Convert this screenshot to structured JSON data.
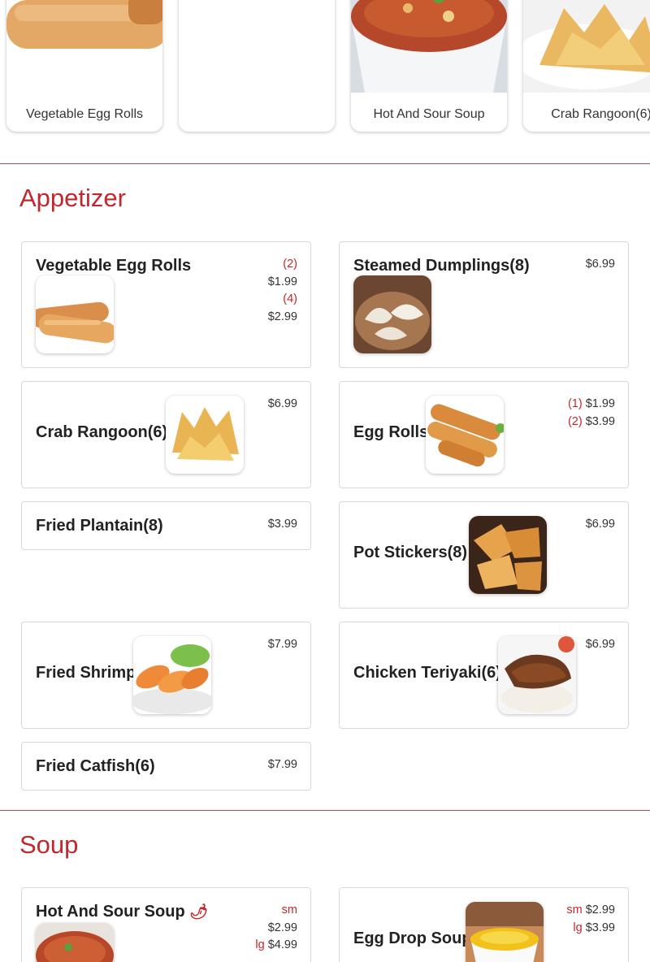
{
  "carousel": {
    "cards": [
      {
        "caption": "Vegetable Egg Rolls",
        "image": "egg-rolls-image"
      },
      {
        "caption": "",
        "image": "blank-image"
      },
      {
        "caption": "Hot And Sour Soup",
        "image": "soup-image"
      },
      {
        "caption": "Crab Rangoon(6)",
        "image": "crab-rangoon-image"
      }
    ]
  },
  "sections": {
    "appetizer": {
      "title": "Appetizer",
      "items": [
        {
          "name": "Vegetable Egg Rolls",
          "prices": [
            {
              "qual": "(2)",
              "price": "$1.99"
            },
            {
              "qual": "(4)",
              "price": "$2.99"
            }
          ]
        },
        {
          "name": "Steamed Dumplings(8)",
          "prices": [
            {
              "qual": "",
              "price": "$6.99"
            }
          ]
        },
        {
          "name": "Crab Rangoon(6)",
          "prices": [
            {
              "qual": "",
              "price": "$6.99"
            }
          ]
        },
        {
          "name": "Egg Rolls",
          "prices": [
            {
              "qual": "(1)",
              "price": "$1.99"
            },
            {
              "qual": "(2)",
              "price": "$3.99"
            }
          ]
        },
        {
          "name": "Fried Plantain(8)",
          "prices": [
            {
              "qual": "",
              "price": "$3.99"
            }
          ]
        },
        {
          "name": "Pot Stickers(8)",
          "prices": [
            {
              "qual": "",
              "price": "$6.99"
            }
          ]
        },
        {
          "name": "Fried Shrimp",
          "prices": [
            {
              "qual": "",
              "price": "$7.99"
            }
          ]
        },
        {
          "name": "Chicken Teriyaki(6)",
          "prices": [
            {
              "qual": "",
              "price": "$6.99"
            }
          ]
        },
        {
          "name": "Fried Catfish(6)",
          "prices": [
            {
              "qual": "",
              "price": "$7.99"
            }
          ]
        }
      ]
    },
    "soup": {
      "title": "Soup",
      "items": [
        {
          "name": "Hot And Sour Soup",
          "spicy_icon": "chili-pepper-icon",
          "prices": [
            {
              "qual": "sm",
              "price": ""
            },
            {
              "qual": "",
              "price": "$2.99"
            },
            {
              "qual": "lg",
              "price": "$4.99"
            }
          ]
        },
        {
          "name": "Egg Drop Soup",
          "prices": [
            {
              "qual": "sm",
              "price": "$2.99"
            },
            {
              "qual": "lg",
              "price": "$3.99"
            }
          ]
        }
      ]
    }
  },
  "colors": {
    "accent": "#c0282e",
    "divider": "#c8444a",
    "border": "#d9d9d9"
  }
}
